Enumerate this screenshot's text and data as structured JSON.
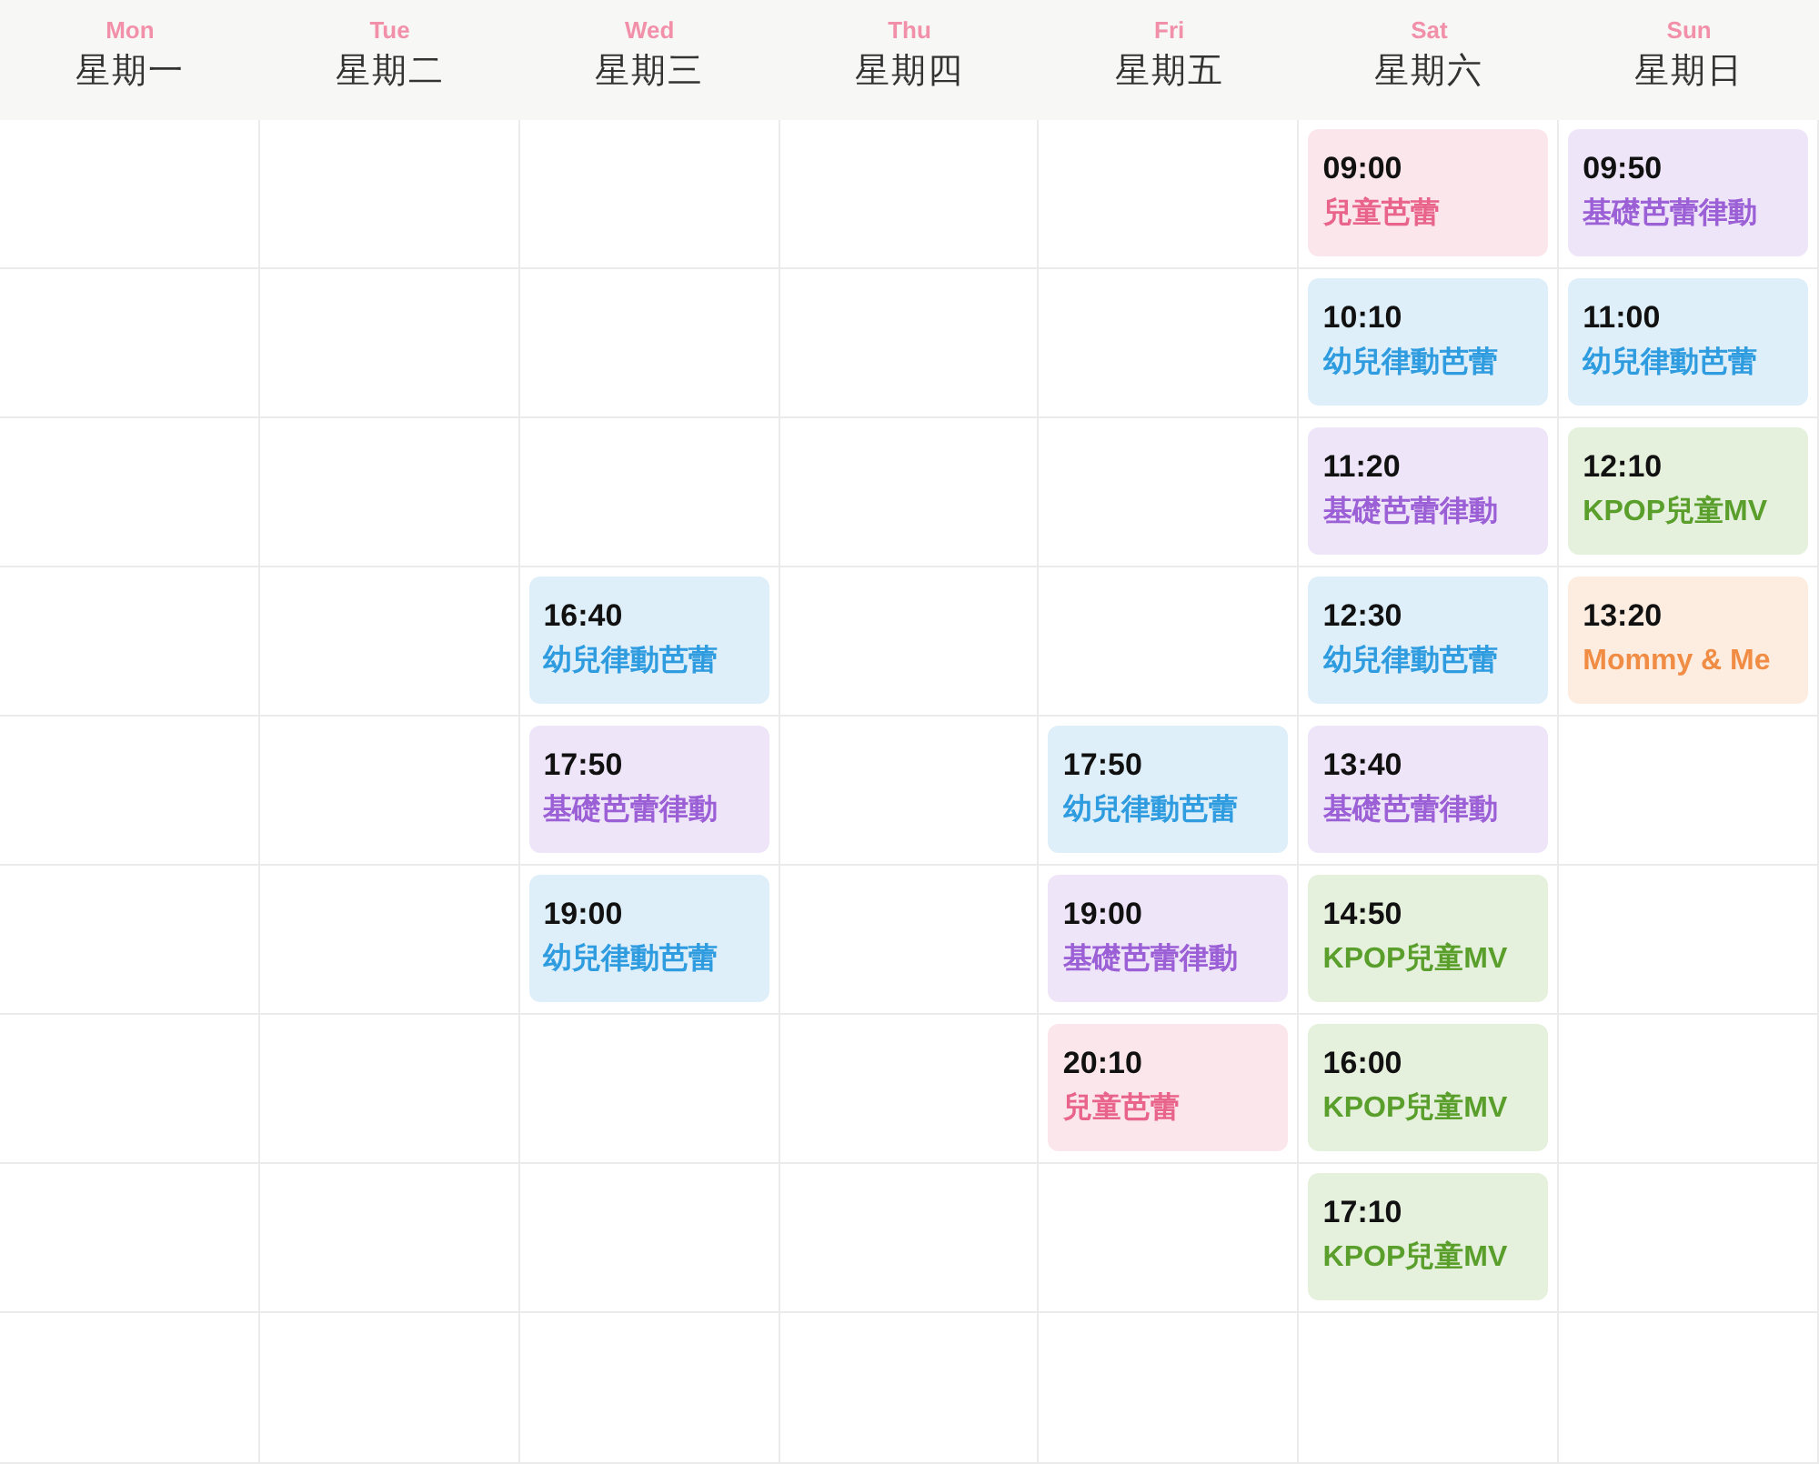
{
  "days": [
    {
      "en": "Mon",
      "zh": "星期一"
    },
    {
      "en": "Tue",
      "zh": "星期二"
    },
    {
      "en": "Wed",
      "zh": "星期三"
    },
    {
      "en": "Thu",
      "zh": "星期四"
    },
    {
      "en": "Fri",
      "zh": "星期五"
    },
    {
      "en": "Sat",
      "zh": "星期六"
    },
    {
      "en": "Sun",
      "zh": "星期日"
    }
  ],
  "rows": [
    {
      "cells": [
        {
          "kind": "empty"
        },
        {
          "kind": "empty"
        },
        {
          "kind": "empty"
        },
        {
          "kind": "empty"
        },
        {
          "kind": "empty"
        },
        {
          "kind": "class",
          "time": "09:00",
          "name": "兒童芭蕾",
          "color": "#e9648b"
        },
        {
          "kind": "class",
          "time": "09:50",
          "name": "基礎芭蕾律動",
          "color": "#9b5fd6"
        }
      ]
    },
    {
      "cells": [
        {
          "kind": "empty"
        },
        {
          "kind": "empty"
        },
        {
          "kind": "empty"
        },
        {
          "kind": "empty"
        },
        {
          "kind": "empty"
        },
        {
          "kind": "class",
          "time": "10:10",
          "name": "幼兒律動芭蕾",
          "color": "#2f9ce0"
        },
        {
          "kind": "class",
          "time": "11:00",
          "name": "幼兒律動芭蕾",
          "color": "#2f9ce0"
        }
      ]
    },
    {
      "cells": [
        {
          "kind": "empty"
        },
        {
          "kind": "empty"
        },
        {
          "kind": "empty"
        },
        {
          "kind": "empty"
        },
        {
          "kind": "empty"
        },
        {
          "kind": "class",
          "time": "11:20",
          "name": "基礎芭蕾律動",
          "color": "#9b5fd6"
        },
        {
          "kind": "class",
          "time": "12:10",
          "name": "KPOP兒童MV",
          "color": "#5a9f2c"
        }
      ]
    },
    {
      "cells": [
        {
          "kind": "empty"
        },
        {
          "kind": "empty"
        },
        {
          "kind": "class",
          "time": "16:40",
          "name": "幼兒律動芭蕾",
          "color": "#2f9ce0"
        },
        {
          "kind": "empty"
        },
        {
          "kind": "empty"
        },
        {
          "kind": "class",
          "time": "12:30",
          "name": "幼兒律動芭蕾",
          "color": "#2f9ce0"
        },
        {
          "kind": "class",
          "time": "13:20",
          "name": "Mommy & Me",
          "color": "#f08c44"
        }
      ]
    },
    {
      "cells": [
        {
          "kind": "empty"
        },
        {
          "kind": "empty"
        },
        {
          "kind": "class",
          "time": "17:50",
          "name": "基礎芭蕾律動",
          "color": "#9b5fd6"
        },
        {
          "kind": "empty"
        },
        {
          "kind": "class",
          "time": "17:50",
          "name": "幼兒律動芭蕾",
          "color": "#2f9ce0"
        },
        {
          "kind": "class",
          "time": "13:40",
          "name": "基礎芭蕾律動",
          "color": "#9b5fd6"
        },
        {
          "kind": "empty"
        }
      ]
    },
    {
      "cells": [
        {
          "kind": "empty"
        },
        {
          "kind": "empty"
        },
        {
          "kind": "class",
          "time": "19:00",
          "name": "幼兒律動芭蕾",
          "color": "#2f9ce0"
        },
        {
          "kind": "empty"
        },
        {
          "kind": "class",
          "time": "19:00",
          "name": "基礎芭蕾律動",
          "color": "#9b5fd6"
        },
        {
          "kind": "class",
          "time": "14:50",
          "name": "KPOP兒童MV",
          "color": "#5a9f2c"
        },
        {
          "kind": "empty"
        }
      ]
    },
    {
      "cells": [
        {
          "kind": "empty"
        },
        {
          "kind": "empty"
        },
        {
          "kind": "empty"
        },
        {
          "kind": "empty"
        },
        {
          "kind": "class",
          "time": "20:10",
          "name": "兒童芭蕾",
          "color": "#e9648b"
        },
        {
          "kind": "class",
          "time": "16:00",
          "name": "KPOP兒童MV",
          "color": "#5a9f2c"
        },
        {
          "kind": "empty"
        }
      ]
    },
    {
      "cells": [
        {
          "kind": "empty"
        },
        {
          "kind": "empty"
        },
        {
          "kind": "empty"
        },
        {
          "kind": "empty"
        },
        {
          "kind": "empty"
        },
        {
          "kind": "class",
          "time": "17:10",
          "name": "KPOP兒童MV",
          "color": "#5a9f2c"
        },
        {
          "kind": "empty"
        }
      ]
    },
    {
      "cells": [
        {
          "kind": "empty"
        },
        {
          "kind": "empty"
        },
        {
          "kind": "empty"
        },
        {
          "kind": "empty"
        },
        {
          "kind": "empty"
        },
        {
          "kind": "empty"
        },
        {
          "kind": "empty"
        }
      ]
    }
  ]
}
